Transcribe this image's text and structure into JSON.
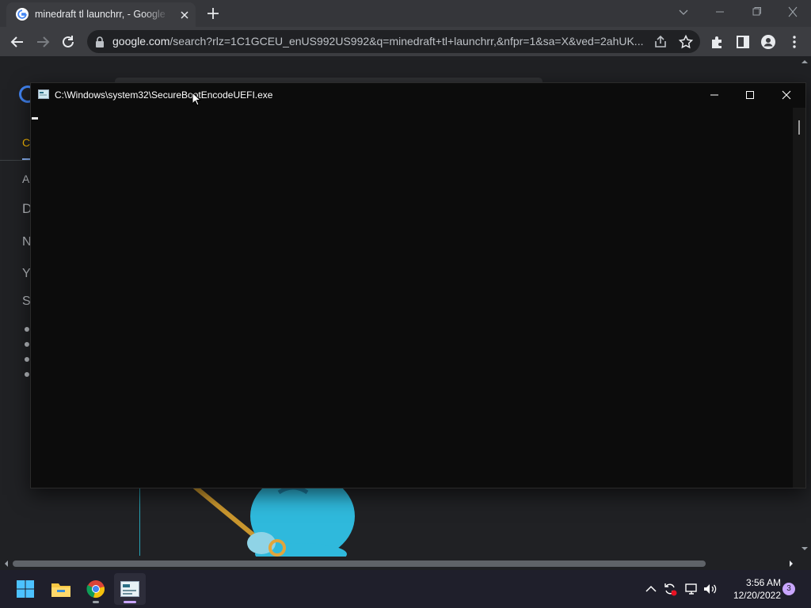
{
  "browser": {
    "tab": {
      "title": "minedraft tl launchrr, - Google Se"
    },
    "url": {
      "domain": "google.com",
      "path": "/search?rlz=1C1GCEU_enUS992US992&q=minedraft+tl+launchrr,&nfpr=1&sa=X&ved=2ahUK..."
    }
  },
  "page_behind": {
    "nav_tab_fragment": "C",
    "fragments": [
      "A",
      "D",
      "N",
      "Y",
      "S"
    ]
  },
  "console": {
    "title": "C:\\Windows\\system32\\SecureBootEncodeUEFI.exe"
  },
  "taskbar": {
    "time": "3:56 AM",
    "date": "12/20/2022",
    "notification_count": "3"
  },
  "colors": {
    "chrome_tabstrip": "#35363a",
    "chrome_toolbar": "#3c3d41",
    "console_bg": "#0c0c0c",
    "taskbar_bg": "#1f1f2b",
    "accent": "#c9a6ff"
  }
}
